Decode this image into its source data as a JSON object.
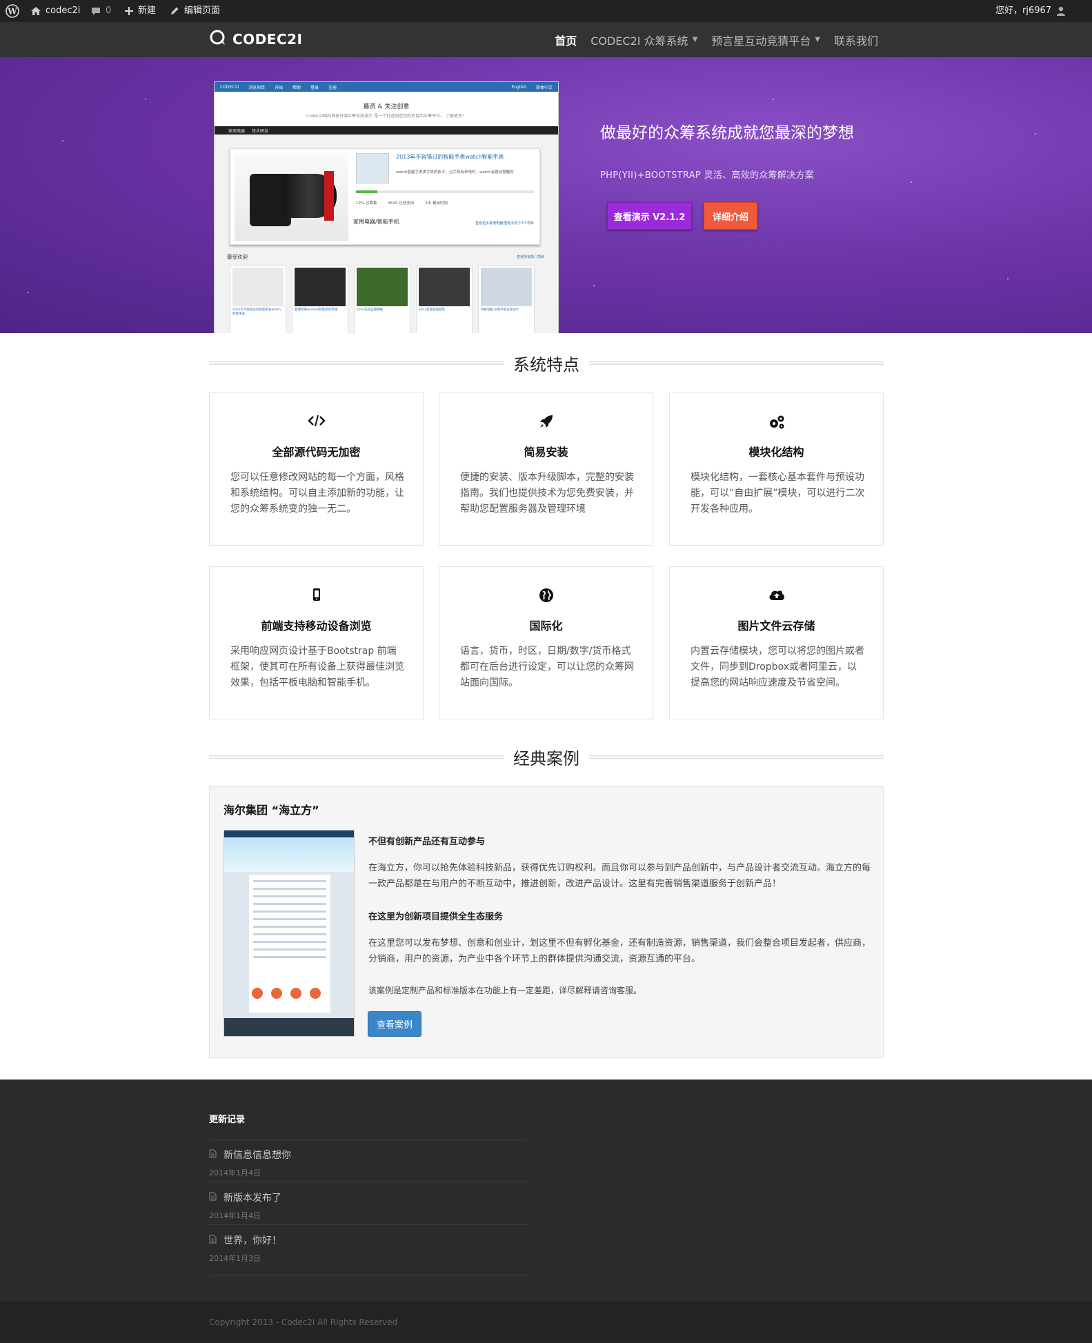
{
  "adminbar": {
    "site_name": "codec2i",
    "comments_count": "0",
    "new_label": "新建",
    "edit_label": "编辑页面",
    "greeting": "您好，rj6967"
  },
  "navbar": {
    "logo_text": "CODEC2I",
    "links": [
      {
        "label": "首页",
        "active": true
      },
      {
        "label": "CODEC2I 众筹系统",
        "dropdown": true
      },
      {
        "label": "预言星互动竞猜平台",
        "dropdown": true
      },
      {
        "label": "联系我们"
      }
    ]
  },
  "hero": {
    "title": "做最好的众筹系统成就您最深的梦想",
    "subtitle": "PHP(YII)+BOOTSTRAP 灵活、高效的众筹解决方案",
    "demo_button": "查看演示 V2.1.2",
    "detail_button": "详细介绍",
    "preview": {
      "nav_items": [
        "CODEC2I",
        "浏览项目",
        "开始",
        "帮助",
        "登录",
        "注册",
        "English",
        "简体中文"
      ],
      "heading": "募资 & 关注创意",
      "subheading": "Codec2i国内首家开源众筹系统演示 是一个打造创造性的项目的众筹平台。 了解更多！",
      "tabs": [
        "家用电器",
        "技术研发"
      ],
      "feature_title": "2013年不容错过的智能手表watch智能手表",
      "feature_desc": "watch智能手表表手机的影子，当手机有来电时，watch会震动提醒你",
      "feature_progress": 0.12,
      "feature_stats": [
        "12% 已筹集",
        "¥620 已获支持",
        "2天 剩余时间"
      ],
      "feature_category": "家用电器/智能手机",
      "feature_more": "查看更多家用电器/智能手机下3个项目",
      "popular_label": "最受欢迎",
      "popular_more": "查看所有热门项目",
      "cards": [
        "2013年不容错过的智能手表watch智能手表",
        "超薄苹果Android智能手机苹果",
        "amia花卉盆栽种植",
        "amia智能家居套装",
        "平板电脑 创意平板支架设计"
      ]
    }
  },
  "features_section": {
    "title": "系统特点",
    "items": [
      {
        "icon": "code-icon",
        "title": "全部源代码无加密",
        "desc": "您可以任意修改网站的每一个方面，风格和系统结构。可以自主添加新的功能，让您的众筹系统变的独一无二。"
      },
      {
        "icon": "rocket-icon",
        "title": "简易安装",
        "desc": "便捷的安装、版本升级脚本，完整的安装指南。我们也提供技术为您免费安装，并帮助您配置服务器及管理环境"
      },
      {
        "icon": "gears-icon",
        "title": "模块化结构",
        "desc": "模块化结构，一套核心基本套件与预设功能，可以“自由扩展”模块，可以进行二次开发各种应用。"
      },
      {
        "icon": "mobile-icon",
        "title": "前端支持移动设备浏览",
        "desc": "采用响应网页设计基于Bootstrap 前端框架，使其可在所有设备上获得最佳浏览效果，包括平板电脑和智能手机。"
      },
      {
        "icon": "globe-icon",
        "title": "国际化",
        "desc": "语言，货币，时区，日期/数字/货币格式都可在后台进行设定，可以让您的众筹网站面向国际。"
      },
      {
        "icon": "cloud-upload-icon",
        "title": "图片文件云存储",
        "desc": "内置云存储模块，您可以将您的图片或者文件，同步到Dropbox或者阿里云，以提高您的网站响应速度及节省空间。"
      }
    ]
  },
  "cases_section": {
    "title": "经典案例",
    "case_title": "海尔集团 “海立方”",
    "heading1": "不但有创新产品还有互动参与",
    "para1": "在海立方，你可以抢先体验科技新品，获得优先订购权利。而且你可以参与到产品创新中，与产品设计者交流互动。海立方的每一款产品都是在与用户的不断互动中，推进创新，改进产品设计。这里有完善销售渠道服务于创新产品！",
    "heading2": "在这里为创新项目提供全生态服务",
    "para2": "在这里您可以发布梦想、创意和创业计，划这里不但有孵化基金，还有制造资源，销售渠道，我们会整合项目发起者，供应商，分销商，用户的资源，为产业中各个环节上的群体提供沟通交流，资源互通的平台。",
    "note": "该案例是定制产品和标准版本在功能上有一定差距，详尽解释请咨询客服。",
    "button": "查看案例"
  },
  "footer": {
    "heading": "更新记录",
    "posts": [
      {
        "title": "新信息信息想你",
        "date": "2014年1月4日"
      },
      {
        "title": "新版本发布了",
        "date": "2014年1月4日"
      },
      {
        "title": "世界，你好！",
        "date": "2014年1月3日"
      }
    ],
    "copyright": "Copyright 2013 - Codec2i All Rights Reserved"
  }
}
